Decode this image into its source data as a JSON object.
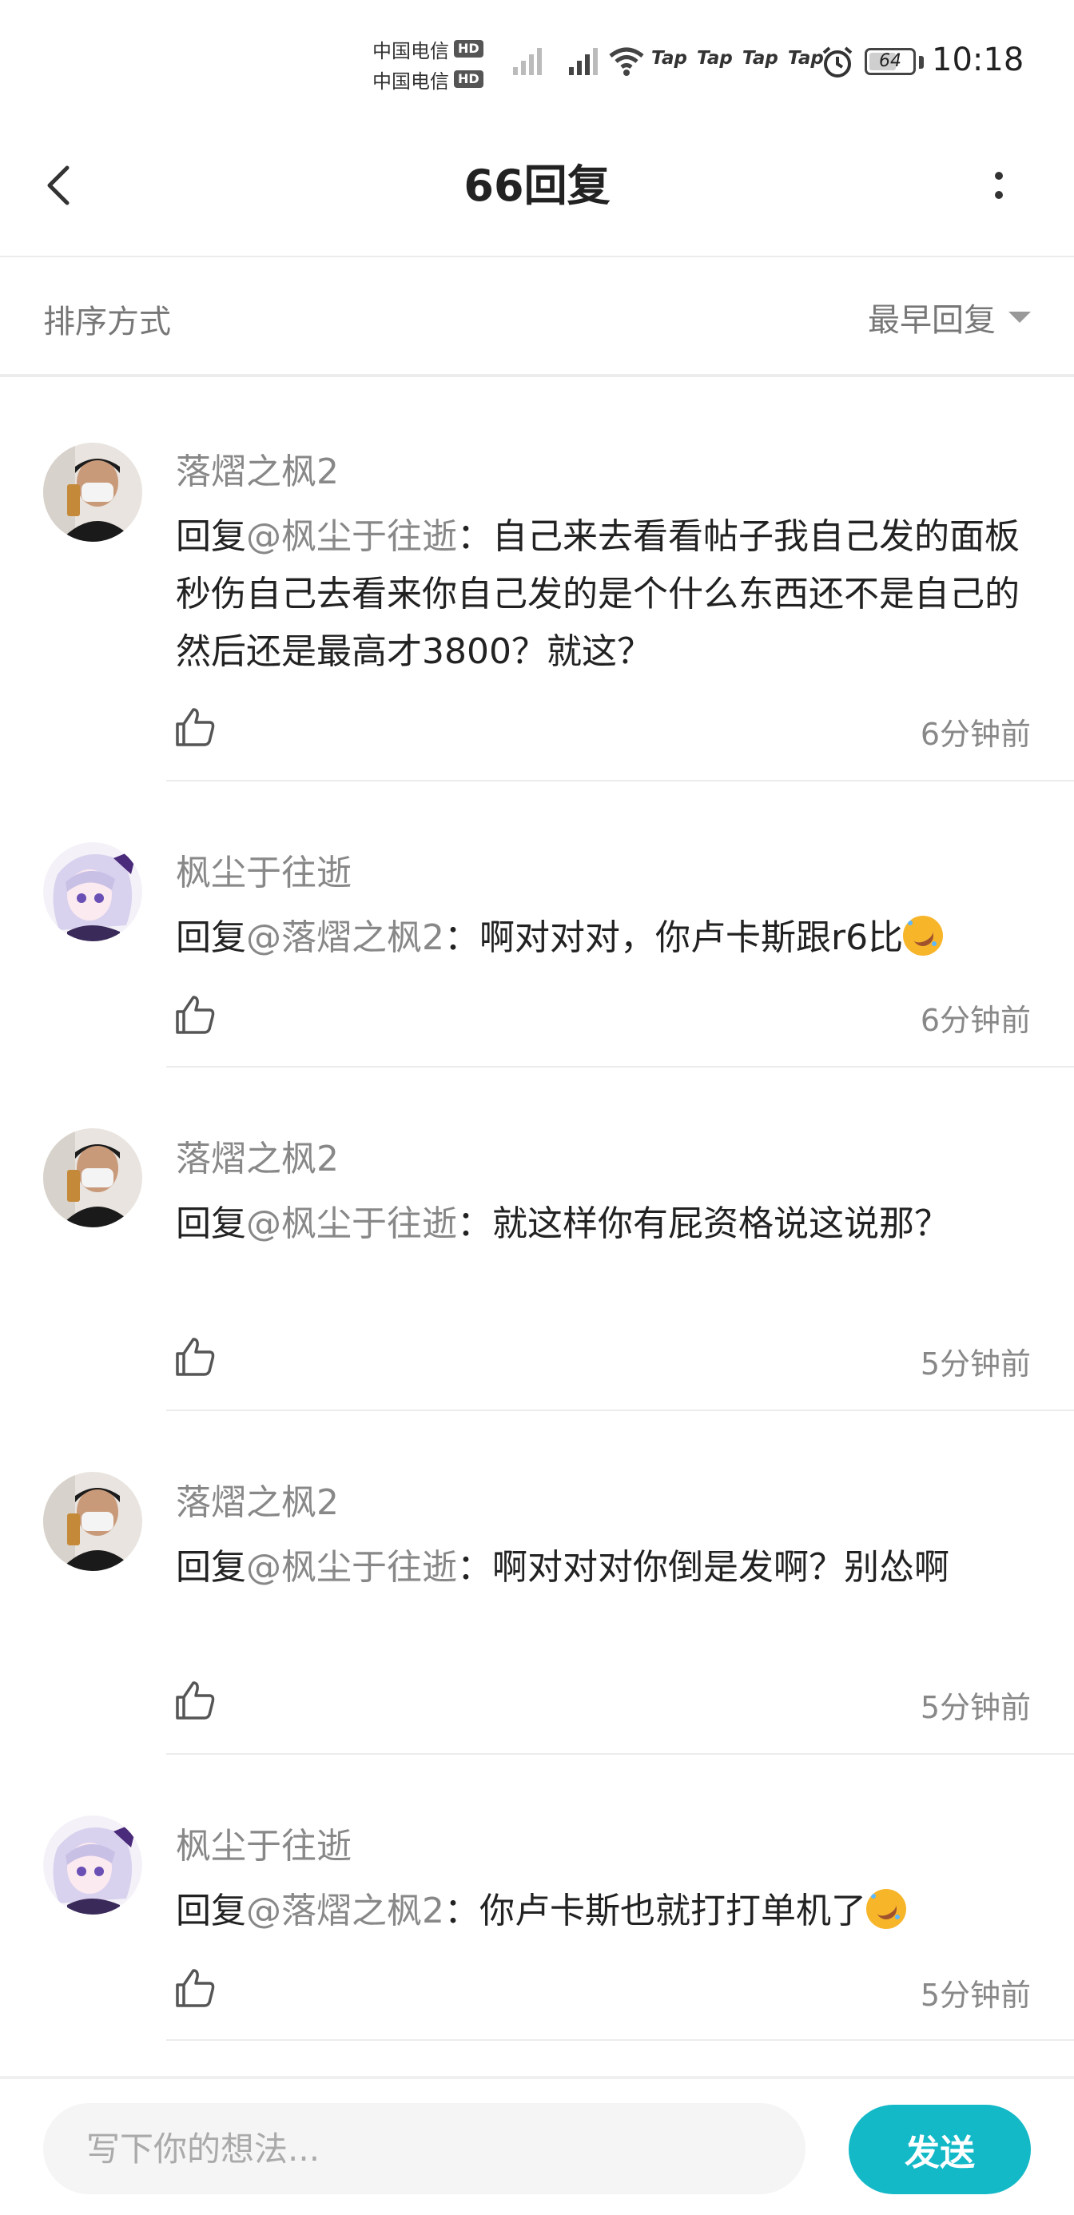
{
  "status_bar": {
    "carrier_1": "中国电信",
    "carrier_2": "中国电信",
    "hd_badge": "HD",
    "tap_labels": [
      "Tap",
      "Tap",
      "Tap",
      "Tap"
    ],
    "battery": "64",
    "battery_level": 0.64,
    "time": "10:18"
  },
  "header": {
    "title": "66回复"
  },
  "sort": {
    "label": "排序方式",
    "selected": "最早回复"
  },
  "comments": [
    {
      "username": "落熠之枫2",
      "reply_prefix": "回复",
      "mention": "@枫尘于往逝",
      "separator": "：",
      "text": "自己来去看看帖子我自己发的面板秒伤自己去看来你自己发的是个什么东西还不是自己的然后还是最高才3800？就这？",
      "time": "6分钟前"
    },
    {
      "username": "枫尘于往逝",
      "reply_prefix": "回复",
      "mention": "@落熠之枫2",
      "separator": "：",
      "text": "啊对对对，你卢卡斯跟r6比",
      "time": "6分钟前"
    },
    {
      "username": "落熠之枫2",
      "reply_prefix": "回复",
      "mention": "@枫尘于往逝",
      "separator": "：",
      "text": "就这样你有屁资格说这说那？",
      "time": "5分钟前"
    },
    {
      "username": "落熠之枫2",
      "reply_prefix": "回复",
      "mention": "@枫尘于往逝",
      "separator": "：",
      "text": "啊对对对你倒是发啊？别怂啊",
      "time": "5分钟前"
    },
    {
      "username": "枫尘于往逝",
      "reply_prefix": "回复",
      "mention": "@落熠之枫2",
      "separator": "：",
      "text": "你卢卡斯也就打打单机了",
      "time": "5分钟前"
    }
  ],
  "composer": {
    "placeholder": "写下你的想法...",
    "send_label": "发送"
  },
  "colors": {
    "accent": "#14b9c8",
    "meta_text": "#888888",
    "body_text": "#222222"
  }
}
